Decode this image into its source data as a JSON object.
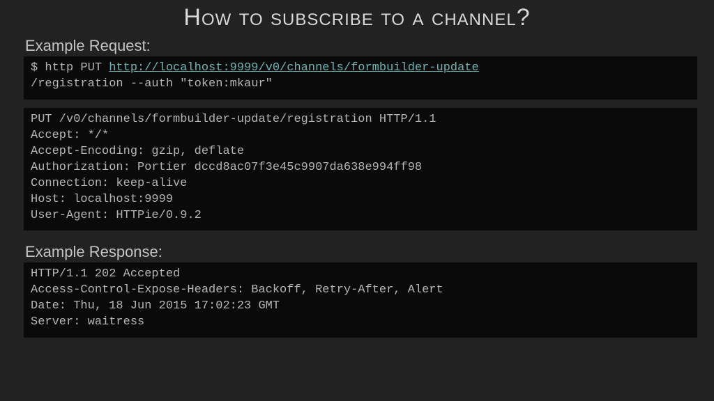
{
  "title": "How to subscribe to a channel?",
  "request": {
    "label": "Example Request:",
    "cmd_prefix": "$ http PUT ",
    "cmd_url": "http://localhost:9999/v0/channels/formbuilder-update",
    "cmd_suffix": "/registration --auth \"token:mkaur\"",
    "raw": "PUT /v0/channels/formbuilder-update/registration HTTP/1.1\nAccept: */*\nAccept-Encoding: gzip, deflate\nAuthorization: Portier dccd8ac07f3e45c9907da638e994ff98\nConnection: keep-alive\nHost: localhost:9999\nUser-Agent: HTTPie/0.9.2"
  },
  "response": {
    "label": "Example Response:",
    "raw": "HTTP/1.1 202 Accepted\nAccess-Control-Expose-Headers: Backoff, Retry-After, Alert\nDate: Thu, 18 Jun 2015 17:02:23 GMT\nServer: waitress"
  }
}
